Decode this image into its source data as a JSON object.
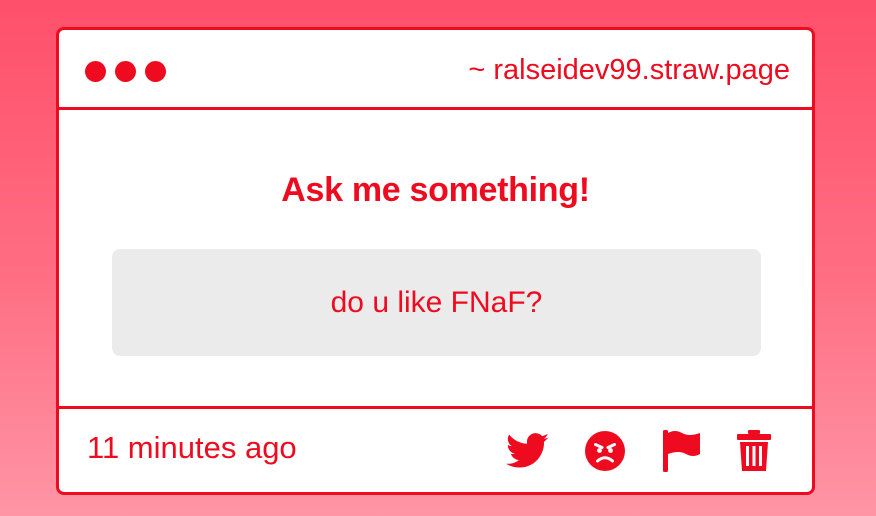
{
  "window": {
    "url": "~ ralseidev99.straw.page"
  },
  "main": {
    "heading": "Ask me something!",
    "question": "do u like FNaF?"
  },
  "footer": {
    "timestamp": "11 minutes ago",
    "actions": [
      {
        "icon": "twitter-icon"
      },
      {
        "icon": "angry-face-icon"
      },
      {
        "icon": "flag-icon"
      },
      {
        "icon": "trash-icon"
      }
    ]
  },
  "colors": {
    "accent": "#ee0b1f",
    "question_box": "#ebebeb",
    "background_top": "#ff4f6a",
    "background_bottom": "#ff95a5"
  }
}
